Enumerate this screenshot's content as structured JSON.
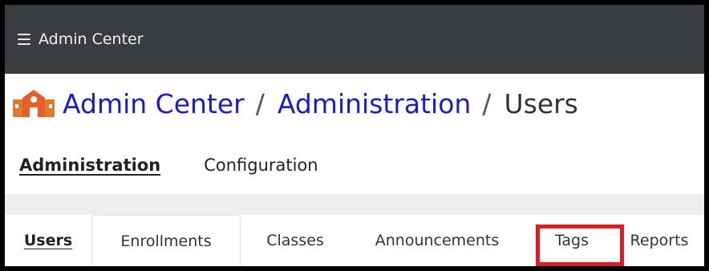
{
  "topbar": {
    "menu_icon": "hamburger-menu-icon",
    "title": "Admin Center"
  },
  "breadcrumb": {
    "icon": "school-building-icon",
    "items": [
      {
        "label": "Admin Center",
        "link": true
      },
      {
        "label": "Administration",
        "link": true
      },
      {
        "label": "Users",
        "link": false
      }
    ],
    "separator": "/"
  },
  "subnav": {
    "items": [
      {
        "label": "Administration",
        "active": true
      },
      {
        "label": "Configuration",
        "active": false
      }
    ]
  },
  "tabs": {
    "items": [
      {
        "label": "Users",
        "active": true
      },
      {
        "label": "Enrollments",
        "active": false
      },
      {
        "label": "Classes",
        "active": false
      },
      {
        "label": "Announcements",
        "active": false
      },
      {
        "label": "Tags",
        "active": false,
        "highlighted": true
      },
      {
        "label": "Reports",
        "active": false
      }
    ]
  },
  "colors": {
    "topbar_bg": "#3a3d40",
    "link": "#1a1ad6",
    "highlight": "#e01a22",
    "band": "#eeeeee"
  }
}
